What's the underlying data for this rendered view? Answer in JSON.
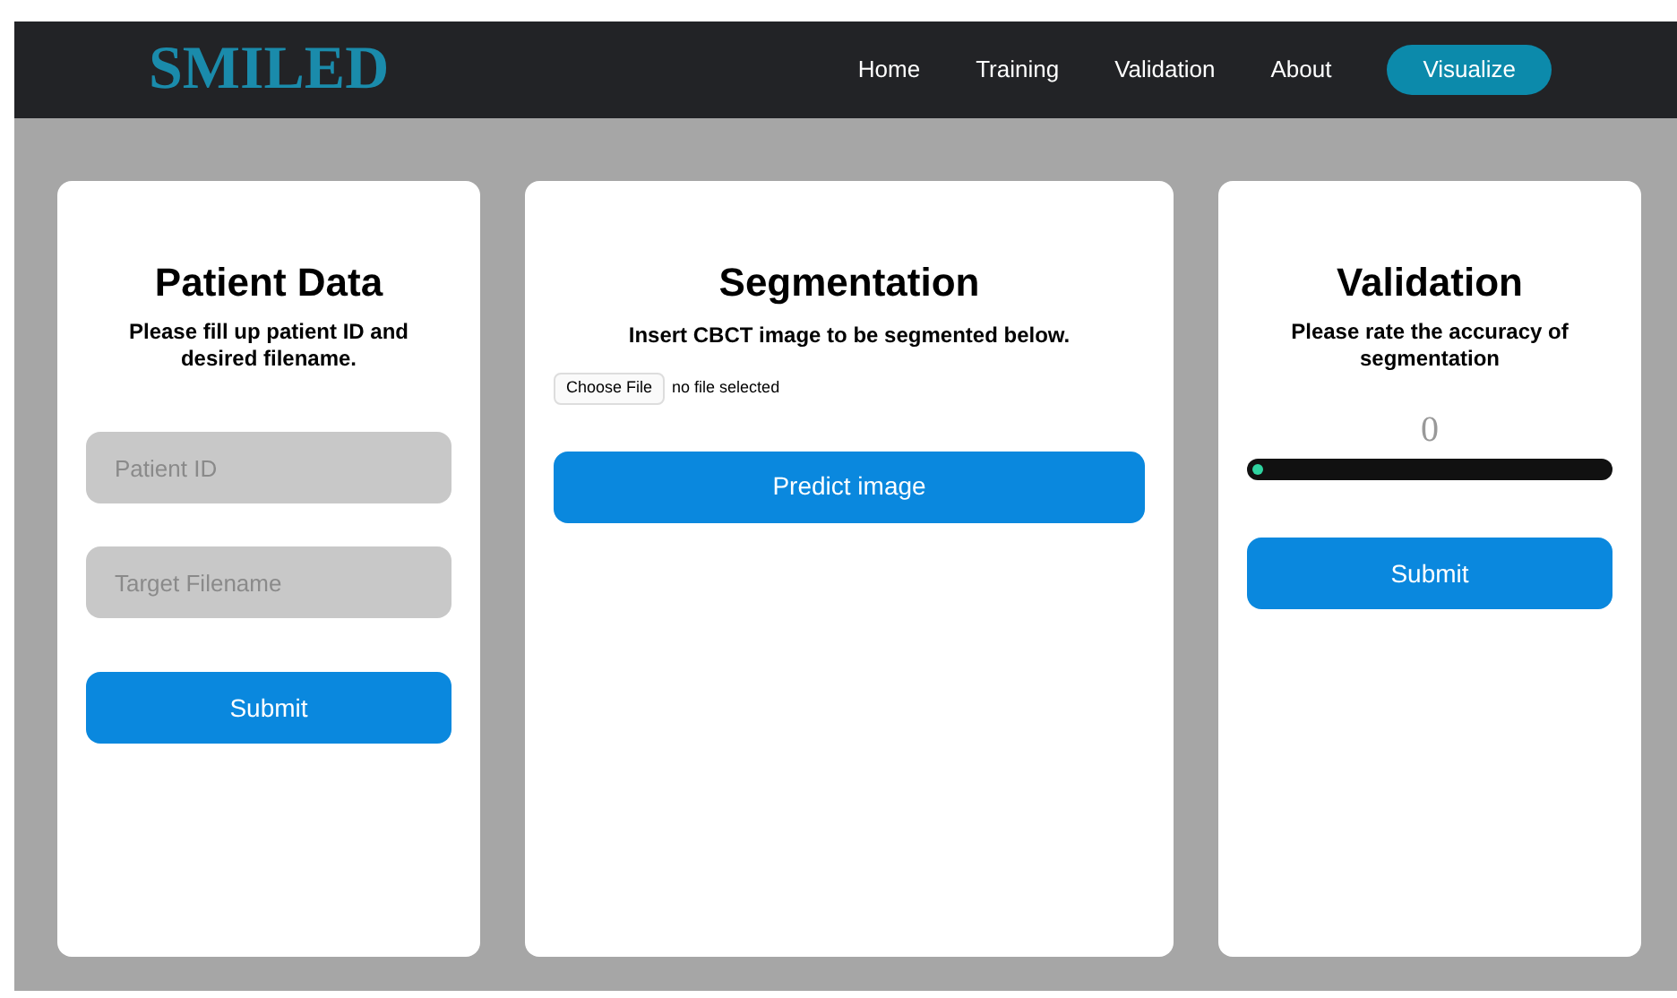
{
  "navbar": {
    "logo": "SMILED",
    "links": [
      {
        "label": "Home"
      },
      {
        "label": "Training"
      },
      {
        "label": "Validation"
      },
      {
        "label": "About"
      }
    ],
    "cta": "Visualize"
  },
  "patient_card": {
    "title": "Patient Data",
    "subtitle": "Please fill up patient ID and desired filename.",
    "fields": [
      {
        "placeholder": "Patient ID"
      },
      {
        "placeholder": "Target Filename"
      }
    ],
    "button": "Submit"
  },
  "segmentation_card": {
    "title": "Segmentation",
    "subtitle": "Insert CBCT image to be segmented below.",
    "file_button": "Choose File",
    "file_status": "no file selected",
    "button": "Predict image"
  },
  "validation_card": {
    "title": "Validation",
    "subtitle": "Please rate the accuracy of segmentation",
    "rating_value": "0",
    "slider": {
      "level": 0
    },
    "button": "Submit"
  }
}
